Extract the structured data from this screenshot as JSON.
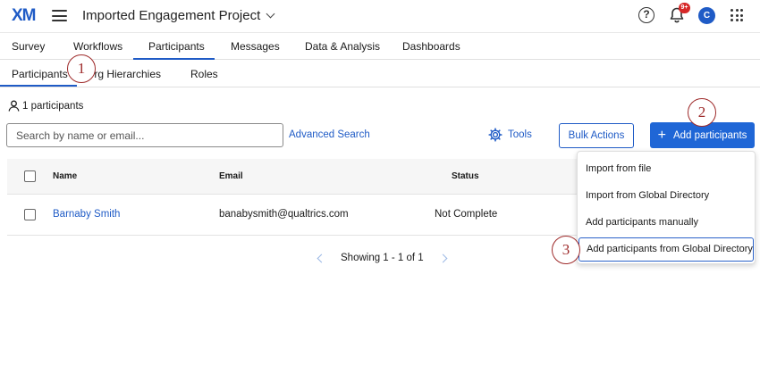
{
  "topbar": {
    "logo": "XM",
    "project_title": "Imported Engagement Project",
    "help_label": "?",
    "notification_badge": "9+",
    "avatar_initial": "C"
  },
  "main_tabs": [
    {
      "label": "Survey"
    },
    {
      "label": "Workflows"
    },
    {
      "label": "Participants"
    },
    {
      "label": "Messages"
    },
    {
      "label": "Data & Analysis"
    },
    {
      "label": "Dashboards"
    }
  ],
  "sub_tabs": [
    {
      "label": "Participants"
    },
    {
      "label": "Org Hierarchies"
    },
    {
      "label": "Roles"
    }
  ],
  "participants_count": "1 participants",
  "search": {
    "placeholder": "Search by name or email..."
  },
  "actions": {
    "advanced_search": "Advanced Search",
    "tools": "Tools",
    "bulk_actions": "Bulk Actions",
    "add_participants": "Add participants",
    "add_icon": "+"
  },
  "table": {
    "headers": [
      "Name",
      "Email",
      "Status"
    ],
    "rows": [
      {
        "name": "Barnaby Smith",
        "email": "banabysmith@qualtrics.com",
        "status": "Not Complete"
      }
    ]
  },
  "pagination": {
    "text": "Showing 1 - 1 of 1"
  },
  "dropdown": {
    "items": [
      "Import from file",
      "Import from Global Directory",
      "Add participants manually",
      "Add participants from Global Directory"
    ]
  },
  "callouts": [
    "1",
    "2",
    "3"
  ],
  "colors": {
    "accent": "#1f5bc6",
    "primary_button": "#1f66d6",
    "callout": "#9e2a2a",
    "badge": "#d62828"
  }
}
